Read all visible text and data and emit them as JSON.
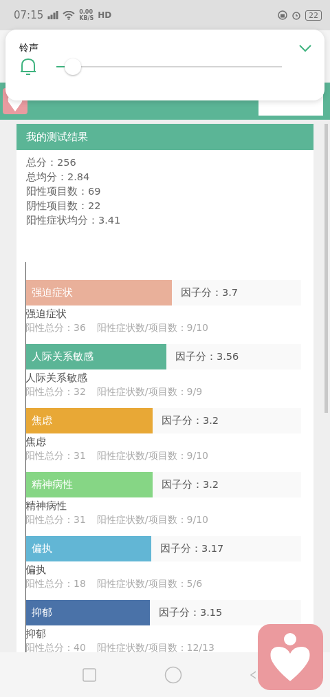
{
  "status_bar": {
    "time": "07:15",
    "net_speed": "0.00",
    "net_unit": "KB/S",
    "hd": "HD",
    "battery": "22"
  },
  "volume_popup": {
    "label": "铃声",
    "level": 0.07
  },
  "card": {
    "title": "我的测试结果",
    "stats": [
      "总分：256",
      "总均分：2.84",
      "阳性项目数：69",
      "阴性项目数：22",
      "阳性症状均分：3.41"
    ],
    "factors": [
      {
        "bar_label": "强迫症状",
        "score": "因子分：3.7",
        "level": 0.53,
        "color": "#e9b09a",
        "name": "强迫症状",
        "positive_total": "阳性总分：36",
        "ratio": "阳性症状数/项目数：9/10"
      },
      {
        "bar_label": "人际关系敏感",
        "score": "因子分：3.56",
        "level": 0.51,
        "color": "#5bb596",
        "name": "人际关系敏感",
        "positive_total": "阳性总分：32",
        "ratio": "阳性症状数/项目数：9/9"
      },
      {
        "bar_label": "焦虑",
        "score": "因子分：3.2",
        "level": 0.46,
        "color": "#e8a836",
        "name": "焦虑",
        "positive_total": "阳性总分：31",
        "ratio": "阳性症状数/项目数：9/10"
      },
      {
        "bar_label": "精神病性",
        "score": "因子分：3.2",
        "level": 0.46,
        "color": "#86d685",
        "name": "精神病性",
        "positive_total": "阳性总分：31",
        "ratio": "阳性症状数/项目数：9/10"
      },
      {
        "bar_label": "偏执",
        "score": "因子分：3.17",
        "level": 0.455,
        "color": "#62b6d5",
        "name": "偏执",
        "positive_total": "阳性总分：18",
        "ratio": "阳性症状数/项目数：5/6"
      },
      {
        "bar_label": "抑郁",
        "score": "因子分：3.15",
        "level": 0.45,
        "color": "#4a72a8",
        "name": "抑郁",
        "positive_total": "阳性总分：40",
        "ratio": "阳性症状数/项目数：12/13"
      }
    ]
  }
}
